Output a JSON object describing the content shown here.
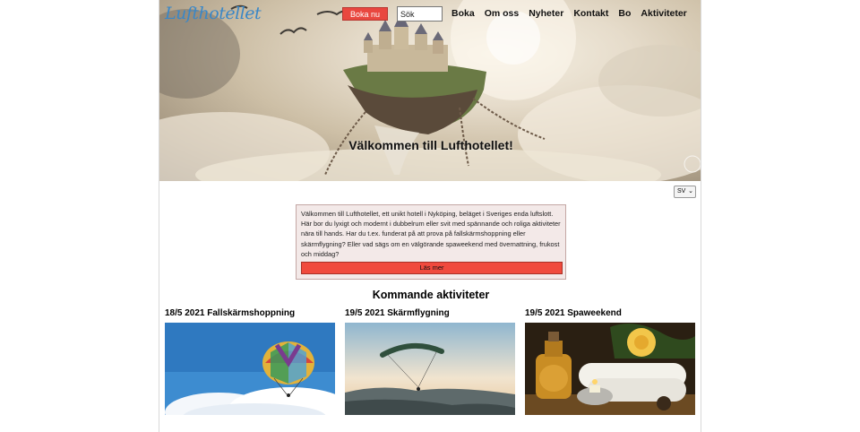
{
  "header": {
    "logo": "Lufthotellet",
    "book_button": "Boka nu",
    "search_placeholder": "Sök",
    "nav": [
      "Boka",
      "Om oss",
      "Nyheter",
      "Kontakt",
      "Bo",
      "Aktiviteter"
    ]
  },
  "hero": {
    "title": "Välkommen till Lufthotellet!"
  },
  "language": {
    "selected": "SV"
  },
  "intro": {
    "text": "Välkommen till Lufthotellet, ett unikt hotell i Nyköping, beläget i Sveriges enda luftslott. Här bor du lyxigt och modernt i dubbelrum eller svit med spännande och roliga aktiviteter nära till hands. Har du t.ex. funderat på att prova på fallskärmshoppning eller skärmflygning? Eller vad sägs om en välgörande spaweekend med övernattning, frukost och middag?",
    "button": "Läs mer"
  },
  "activities": {
    "title": "Kommande aktiviteter",
    "items": [
      {
        "date_title": "18/5 2021 Fallskärmshoppning"
      },
      {
        "date_title": "19/5 2021 Skärmflygning"
      },
      {
        "date_title": "19/5 2021 Spaweekend"
      }
    ]
  },
  "colors": {
    "accent_red": "#e9473f",
    "logo_blue": "#3a87c7",
    "info_bg": "#f3e9e8"
  }
}
